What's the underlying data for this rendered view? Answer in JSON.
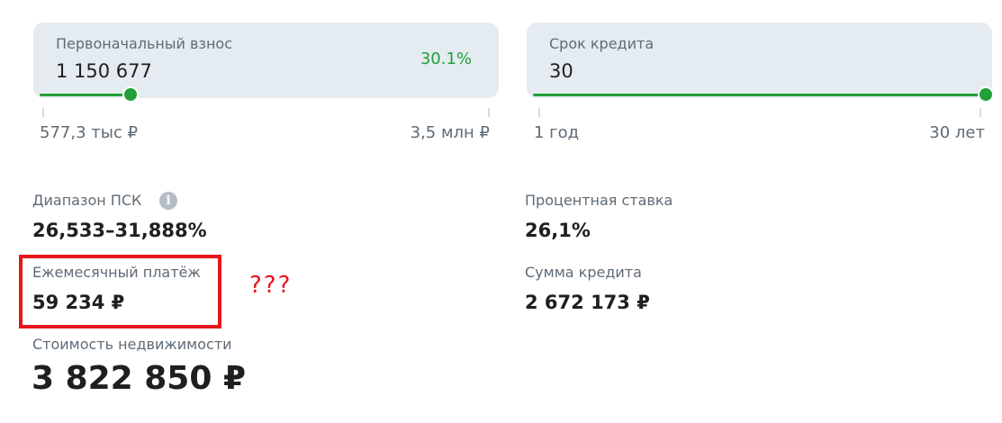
{
  "down_payment": {
    "label": "Первоначальный взнос",
    "value": "1 150 677",
    "percent": "30.1%",
    "min_label": "577,3 тыс ₽",
    "max_label": "3,5 млн ₽",
    "level_fraction": 0.2
  },
  "loan_term": {
    "label": "Срок кредита",
    "value": "30",
    "min_label": "1 год",
    "max_label": "30 лет",
    "level_fraction": 1.0
  },
  "psk": {
    "label": "Диапазон ПСК",
    "value": "26,533–31,888%",
    "info_icon": "i"
  },
  "interest_rate": {
    "label": "Процентная ставка",
    "value": "26,1%"
  },
  "monthly_payment": {
    "label": "Ежемесячный платёж",
    "value": "59 234 ₽"
  },
  "loan_amount": {
    "label": "Сумма кредита",
    "value": "2 672 173 ₽"
  },
  "property_cost": {
    "label": "Стоимость недвижимости",
    "value": "3 822 850 ₽"
  },
  "annotation": {
    "text": "???",
    "color": "#e8141c"
  },
  "colors": {
    "accent": "#21a038",
    "box_bg": "#e4ebf1",
    "highlight": "#e8141c"
  },
  "icons": {
    "info": "info-icon"
  }
}
